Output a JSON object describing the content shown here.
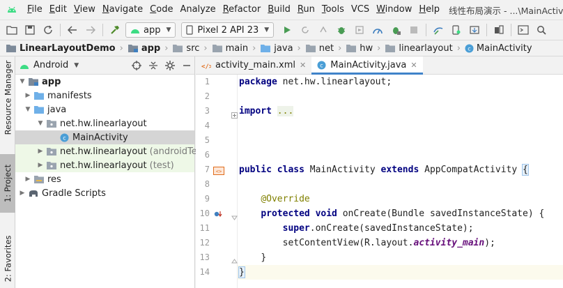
{
  "menubar": {
    "items": [
      {
        "label": "File",
        "u": "F",
        "rest": "ile"
      },
      {
        "label": "Edit",
        "u": "E",
        "rest": "dit"
      },
      {
        "label": "View",
        "u": "V",
        "rest": "iew"
      },
      {
        "label": "Navigate",
        "u": "N",
        "rest": "avigate"
      },
      {
        "label": "Code",
        "u": "C",
        "rest": "ode"
      },
      {
        "label": "Analyze",
        "u": "",
        "rest": "Analyze"
      },
      {
        "label": "Refactor",
        "u": "R",
        "rest": "efactor"
      },
      {
        "label": "Build",
        "u": "B",
        "rest": "uild"
      },
      {
        "label": "Run",
        "u": "R",
        "rest": "un"
      },
      {
        "label": "Tools",
        "u": "T",
        "rest": "ools"
      },
      {
        "label": "VCS",
        "u": "",
        "rest": "VCS"
      },
      {
        "label": "Window",
        "u": "W",
        "rest": "indow"
      },
      {
        "label": "Help",
        "u": "H",
        "rest": "elp"
      }
    ],
    "window_title": "线性布局演示 - ...\\MainActivity.java"
  },
  "toolbar": {
    "run_config": "app",
    "device": "Pixel 2 API 23"
  },
  "breadcrumb": [
    "LinearLayoutDemo",
    "app",
    "src",
    "main",
    "java",
    "net",
    "hw",
    "linearlayout",
    "MainActivity"
  ],
  "toolwindows": {
    "resource_manager": "Resource Manager",
    "project": "1: Project",
    "favorites": "2: Favorites"
  },
  "project": {
    "view_mode": "Android",
    "tree": [
      {
        "label": "app",
        "suffix": ""
      },
      {
        "label": "manifests",
        "suffix": ""
      },
      {
        "label": "java",
        "suffix": ""
      },
      {
        "label": "net.hw.linearlayout",
        "suffix": ""
      },
      {
        "label": "MainActivity",
        "suffix": ""
      },
      {
        "label": "net.hw.linearlayout",
        "suffix": "(androidTest)"
      },
      {
        "label": "net.hw.linearlayout",
        "suffix": "(test)"
      },
      {
        "label": "res",
        "suffix": ""
      },
      {
        "label": "Gradle Scripts",
        "suffix": ""
      }
    ]
  },
  "editor": {
    "tabs": [
      {
        "label": "activity_main.xml"
      },
      {
        "label": "MainActivity.java"
      }
    ],
    "line_numbers": [
      "1",
      "2",
      "3",
      "4",
      "5",
      "6",
      "7",
      "8",
      "9",
      "10",
      "11",
      "12",
      "13",
      "14"
    ],
    "code": {
      "l1_kw": "package",
      "l1_rest": " net.hw.linearlayout;",
      "l3_kw": "import",
      "l3_rest": "...",
      "l7_kw1": "public class",
      "l7_name": " MainActivity ",
      "l7_kw2": "extends",
      "l7_rest": " AppCompatActivity ",
      "l7_brace": "{",
      "l9_ann": "@Override",
      "l10_kw": "protected void",
      "l10_rest": " onCreate(Bundle savedInstanceState) {",
      "l11_kw": "super",
      "l11_rest": ".onCreate(savedInstanceState);",
      "l12_pre": "setContentView(R.layout.",
      "l12_ital": "activity_main",
      "l12_post": ");",
      "l13": "}",
      "l14": "}"
    }
  },
  "colors": {
    "accent": "#4083c9",
    "android_green": "#3ddc84",
    "folder_blue": "#6fb0e8",
    "keyword": "#000080",
    "annotation": "#808000"
  }
}
